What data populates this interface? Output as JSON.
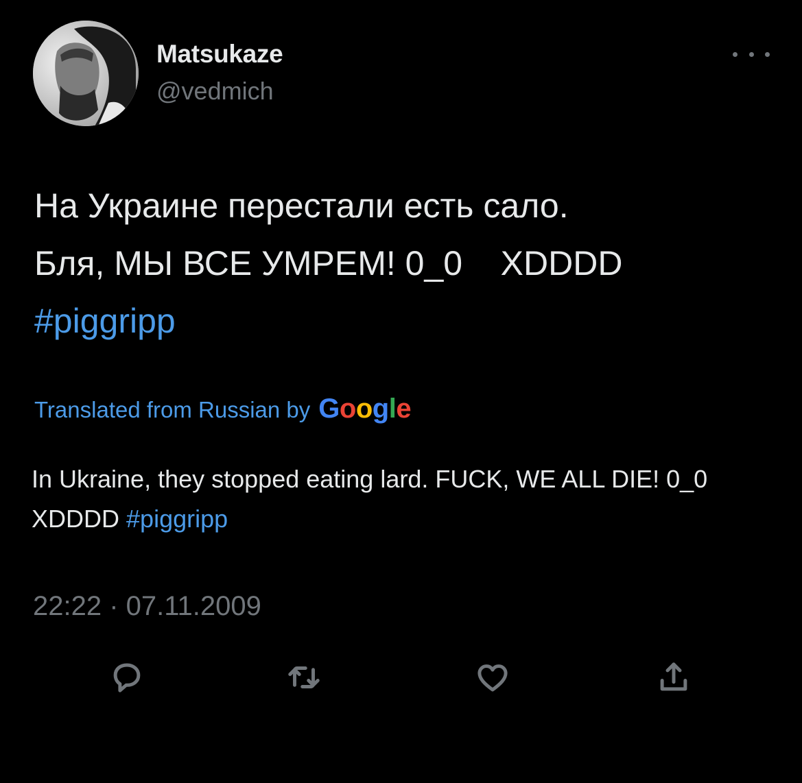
{
  "user": {
    "display_name": "Matsukaze",
    "handle": "@vedmich"
  },
  "tweet": {
    "line1": "На Украине перестали есть сало.",
    "line2": "Бля, МЫ ВСЕ УМРЕМ! 0_0    XDDDD",
    "hashtag": "#piggripp"
  },
  "translation": {
    "label": "Translated from Russian by",
    "provider": "Google",
    "text": "In Ukraine, they stopped eating lard. FUCK, WE ALL DIE! 0_0 XDDDD",
    "hashtag": "#piggripp"
  },
  "timestamp": "22:22 · 07.11.2009",
  "actions": {
    "reply_icon": "reply-icon",
    "retweet_icon": "retweet-icon",
    "like_icon": "like-icon",
    "share_icon": "share-icon"
  },
  "colors": {
    "background": "#000000",
    "text": "#e7e9ea",
    "secondary": "#71767b",
    "link": "#4c9be8"
  }
}
